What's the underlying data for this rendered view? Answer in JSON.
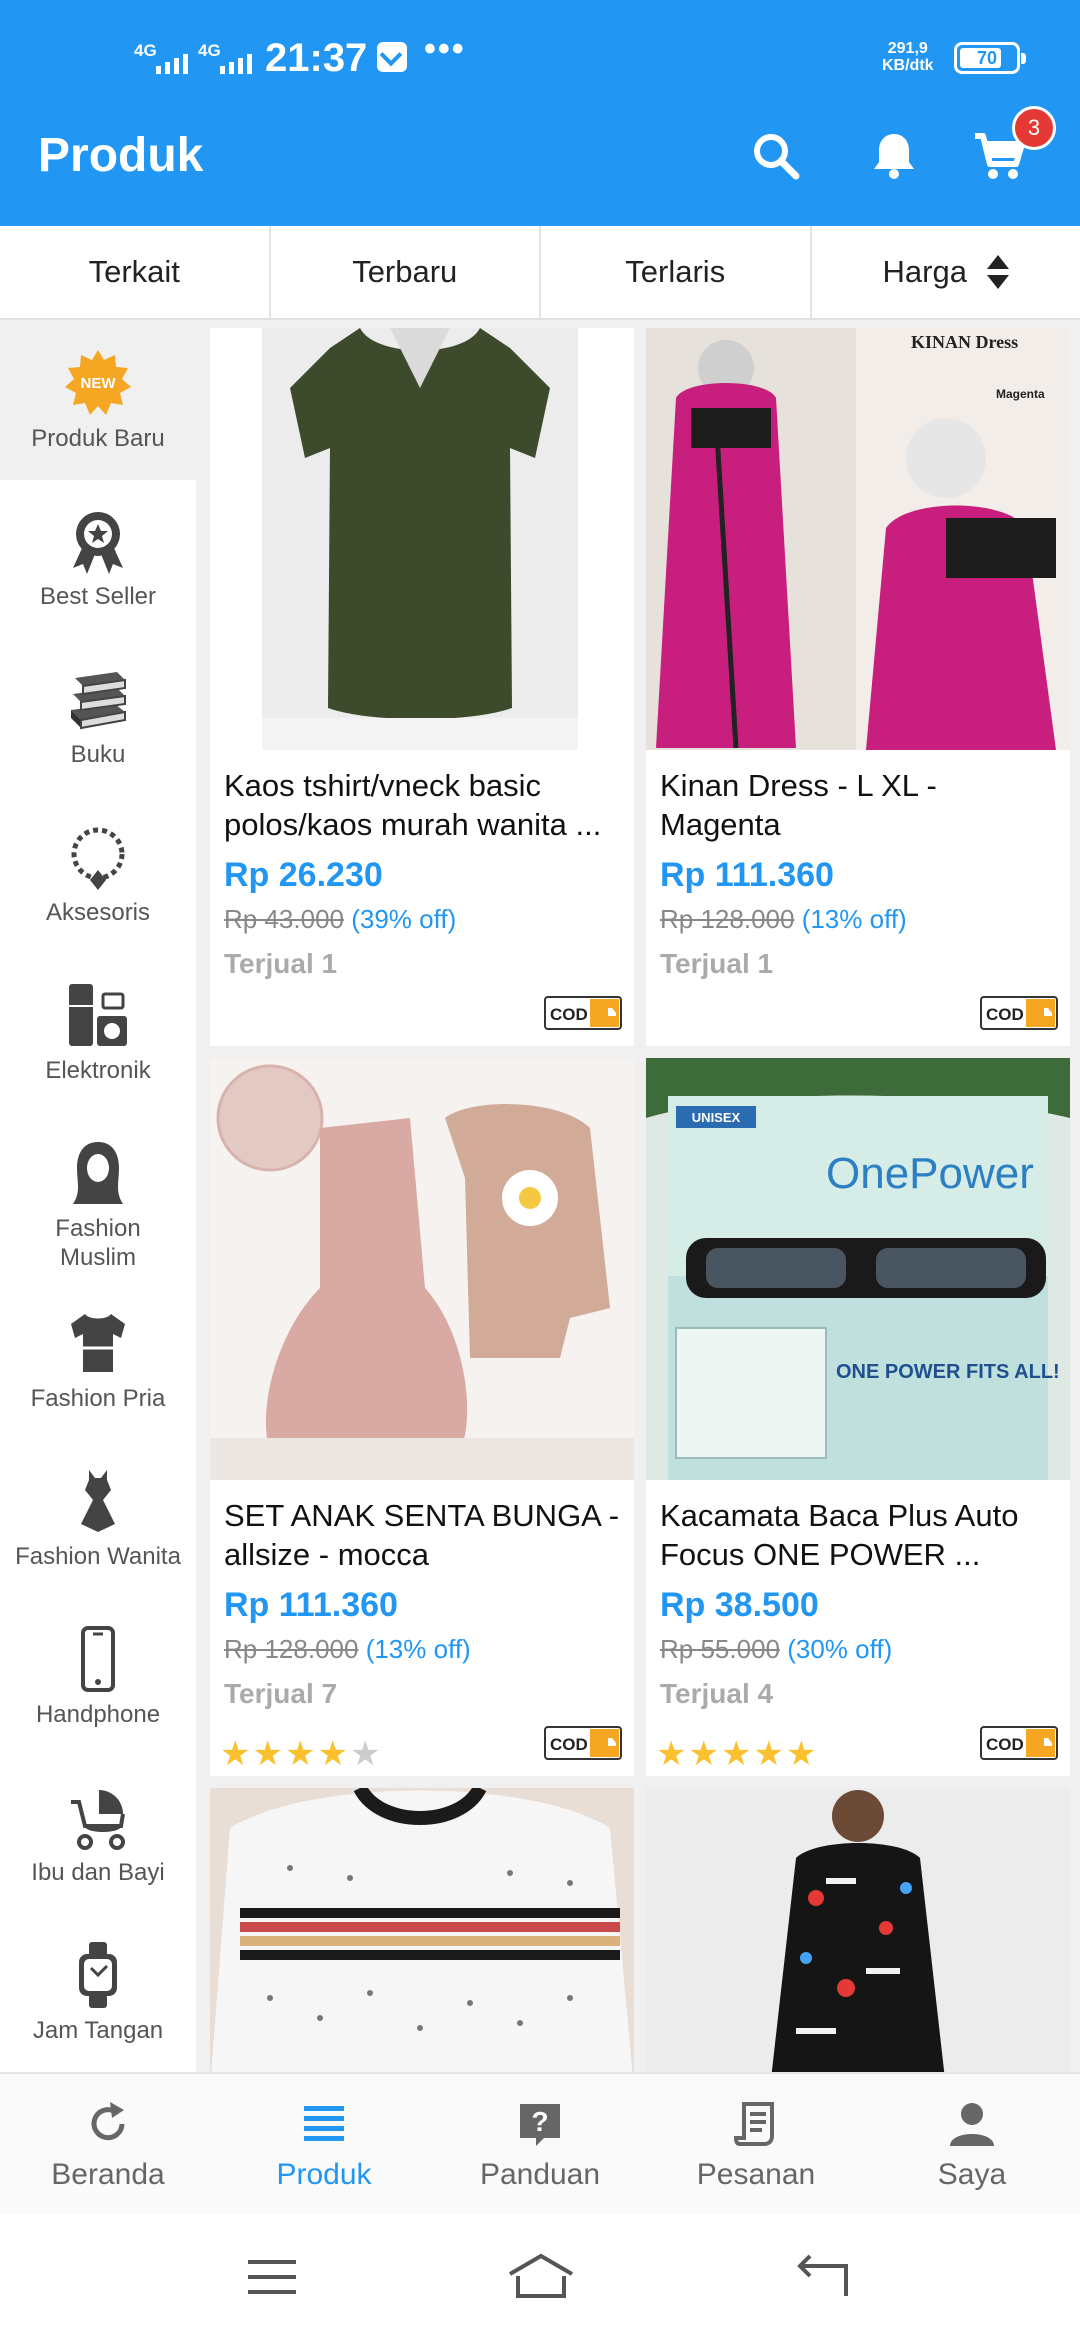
{
  "status_bar": {
    "network_1": "4G",
    "network_2": "4G",
    "time": "21:37",
    "more": "•••",
    "speed_value": "291,9",
    "speed_unit": "KB/dtk",
    "battery": "70"
  },
  "header": {
    "title": "Produk",
    "cart_count": "3",
    "icons": [
      "search-icon",
      "bell-icon",
      "cart-icon"
    ],
    "background_color": "#2196f3"
  },
  "sort_tabs": [
    "Terkait",
    "Terbaru",
    "Terlaris",
    "Harga"
  ],
  "categories": [
    {
      "label": "Produk Baru",
      "icon": "new-badge-icon",
      "badge": "NEW",
      "active": true
    },
    {
      "label": "Best Seller",
      "icon": "award-ribbon-icon"
    },
    {
      "label": "Buku",
      "icon": "books-icon"
    },
    {
      "label": "Aksesoris",
      "icon": "necklace-icon"
    },
    {
      "label": "Elektronik",
      "icon": "appliances-icon"
    },
    {
      "label": "Fashion Muslim",
      "icon": "hijab-icon"
    },
    {
      "label": "Fashion Pria",
      "icon": "men-shirt-icon"
    },
    {
      "label": "Fashion Wanita",
      "icon": "dress-icon"
    },
    {
      "label": "Handphone",
      "icon": "smartphone-icon"
    },
    {
      "label": "Ibu dan Bayi",
      "icon": "stroller-icon"
    },
    {
      "label": "Jam Tangan",
      "icon": "watch-icon"
    }
  ],
  "products": [
    {
      "name": "Kaos tshirt/vneck basic polos/kaos murah wanita ...",
      "price": "Rp 26.230",
      "old_price": "Rp 43.000",
      "discount": "(39% off)",
      "sold": "Terjual 1",
      "rating": null,
      "cod_label": "COD"
    },
    {
      "name": "Kinan Dress - L XL - Magenta",
      "price": "Rp 111.360",
      "old_price": "Rp 128.000",
      "discount": "(13% off)",
      "sold": "Terjual 1",
      "rating": null,
      "cod_label": "COD",
      "image_text_1": "KINAN Dress",
      "image_text_2": "Magenta"
    },
    {
      "name": "SET ANAK SENTA BUNGA  - allsize - mocca",
      "price": "Rp 111.360",
      "old_price": "Rp 128.000",
      "discount": "(13% off)",
      "sold": "Terjual 7",
      "rating": 4,
      "cod_label": "COD"
    },
    {
      "name": "Kacamata Baca Plus Auto Focus ONE POWER ...",
      "price": "Rp 38.500",
      "old_price": "Rp 55.000",
      "discount": "(30% off)",
      "sold": "Terjual 4",
      "rating": 5,
      "cod_label": "COD",
      "image_text_1": "OnePower",
      "image_text_2": "ONE POWER FITS ALL!",
      "image_text_3": "UNISEX"
    },
    {
      "name": "",
      "price": "",
      "old_price": "",
      "discount": "",
      "sold": ""
    },
    {
      "name": "",
      "price": "",
      "old_price": "",
      "discount": "",
      "sold": ""
    }
  ],
  "bottom_nav": [
    {
      "label": "Beranda",
      "icon": "refresh-icon"
    },
    {
      "label": "Produk",
      "icon": "list-icon",
      "active": true
    },
    {
      "label": "Panduan",
      "icon": "help-icon"
    },
    {
      "label": "Pesanan",
      "icon": "receipt-icon"
    },
    {
      "label": "Saya",
      "icon": "user-icon"
    }
  ]
}
